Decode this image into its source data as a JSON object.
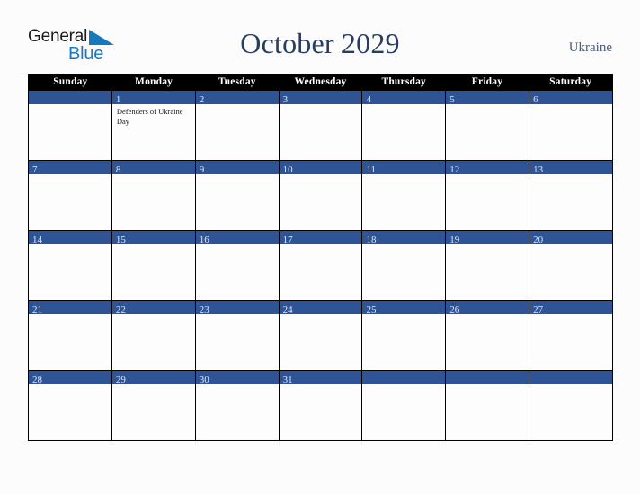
{
  "brand": {
    "name_part1": "General",
    "name_part2": "Blue",
    "triangle_icon": "triangle-icon",
    "color_dark": "#1b1b1b",
    "color_blue": "#1878be"
  },
  "header": {
    "title": "October 2029",
    "country": "Ukraine",
    "title_color": "#2a3c5f",
    "country_color": "#4a5a78"
  },
  "calendar": {
    "month": "October",
    "year": "2029",
    "accent_color": "#2e5496",
    "header_bg": "#000000",
    "weekdays": [
      "Sunday",
      "Monday",
      "Tuesday",
      "Wednesday",
      "Thursday",
      "Friday",
      "Saturday"
    ],
    "weeks": [
      [
        {
          "date": "",
          "events": []
        },
        {
          "date": "1",
          "events": [
            "Defenders of Ukraine Day"
          ]
        },
        {
          "date": "2",
          "events": []
        },
        {
          "date": "3",
          "events": []
        },
        {
          "date": "4",
          "events": []
        },
        {
          "date": "5",
          "events": []
        },
        {
          "date": "6",
          "events": []
        }
      ],
      [
        {
          "date": "7",
          "events": []
        },
        {
          "date": "8",
          "events": []
        },
        {
          "date": "9",
          "events": []
        },
        {
          "date": "10",
          "events": []
        },
        {
          "date": "11",
          "events": []
        },
        {
          "date": "12",
          "events": []
        },
        {
          "date": "13",
          "events": []
        }
      ],
      [
        {
          "date": "14",
          "events": []
        },
        {
          "date": "15",
          "events": []
        },
        {
          "date": "16",
          "events": []
        },
        {
          "date": "17",
          "events": []
        },
        {
          "date": "18",
          "events": []
        },
        {
          "date": "19",
          "events": []
        },
        {
          "date": "20",
          "events": []
        }
      ],
      [
        {
          "date": "21",
          "events": []
        },
        {
          "date": "22",
          "events": []
        },
        {
          "date": "23",
          "events": []
        },
        {
          "date": "24",
          "events": []
        },
        {
          "date": "25",
          "events": []
        },
        {
          "date": "26",
          "events": []
        },
        {
          "date": "27",
          "events": []
        }
      ],
      [
        {
          "date": "28",
          "events": []
        },
        {
          "date": "29",
          "events": []
        },
        {
          "date": "30",
          "events": []
        },
        {
          "date": "31",
          "events": []
        },
        {
          "date": "",
          "events": []
        },
        {
          "date": "",
          "events": []
        },
        {
          "date": "",
          "events": []
        }
      ]
    ]
  }
}
